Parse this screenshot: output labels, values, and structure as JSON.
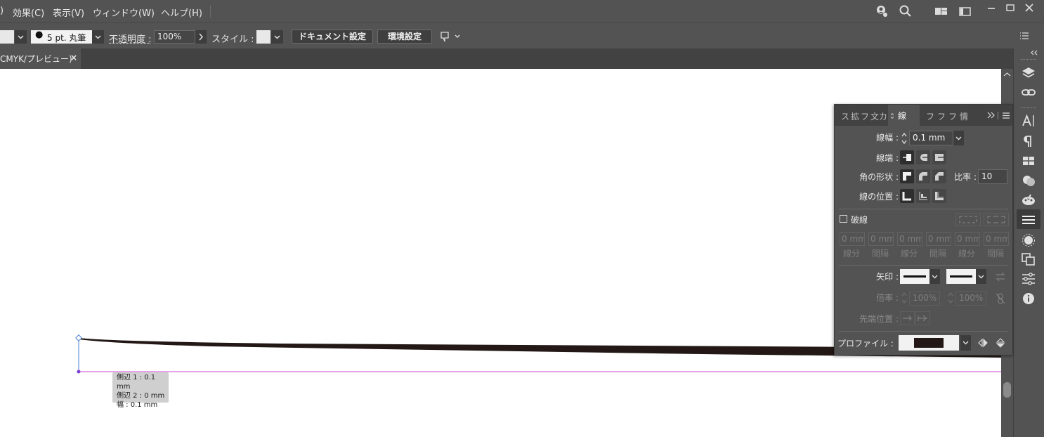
{
  "menubar": {
    "items": [
      {
        "label": ")"
      },
      {
        "label": "効果(C)"
      },
      {
        "label": "表示(V)"
      },
      {
        "label": "ウィンドウ(W)"
      },
      {
        "label": "ヘルプ(H)"
      }
    ]
  },
  "controlbar": {
    "brush_label": "5 pt. 丸筆",
    "opacity_label": "不透明度 :",
    "opacity_value": "100%",
    "style_label": "スタイル :",
    "doc_setup_button": "ドキュメント設定",
    "preferences_button": "環境設定"
  },
  "tabbar": {
    "doc_tab_label": "CMYK/プレビュー)",
    "close_symbol": "×"
  },
  "stroke_panel": {
    "tabs": [
      "ス",
      "拡",
      "フ",
      "文",
      "カ",
      "線",
      "フ",
      "フ",
      "フ",
      "情"
    ],
    "active_tab": "線",
    "weight_label": "線幅 :",
    "weight_value": "0.1 mm",
    "cap_label": "線端 :",
    "corner_label": "角の形状 :",
    "limit_label": "比率 :",
    "limit_value": "10",
    "align_label": "線の位置 :",
    "dashed_label": "破線",
    "dash_values": [
      "0 mm",
      "0 mm",
      "0 mm",
      "0 mm",
      "0 mm",
      "0 mm"
    ],
    "dash_labels": [
      "線分",
      "間隔",
      "線分",
      "間隔",
      "線分",
      "間隔"
    ],
    "arrow_label": "矢印 :",
    "scale_label": "倍率 :",
    "scale_start": "100%",
    "scale_end": "100%",
    "align_tip_label": "先端位置 :",
    "profile_label": "プロファイル :"
  },
  "tooltip": {
    "line1": "側辺 1 : 0.1 mm",
    "line2": "側辺 2 : 0 mm",
    "line3": "幅 : 0.1 mm"
  },
  "colors": {
    "ui_bg": "#535353",
    "panel_tab_bg": "#424242",
    "canvas": "#ffffff",
    "guide": "#cc44cc",
    "stroke": "#231815",
    "selection": "#4a7fd0"
  },
  "icons": {
    "window_controls": [
      "user-icon",
      "search-icon",
      "workspace-icon",
      "arrange-icon",
      "minimize-icon",
      "maximize-icon",
      "close-icon"
    ],
    "dock": [
      "layers-icon",
      "links-icon",
      "character-icon",
      "paragraph-icon",
      "swatches-icon",
      "color-icon",
      "brushes-icon",
      "stroke-icon",
      "appearance-icon",
      "pathfinder-icon",
      "properties-icon",
      "info-icon"
    ]
  }
}
